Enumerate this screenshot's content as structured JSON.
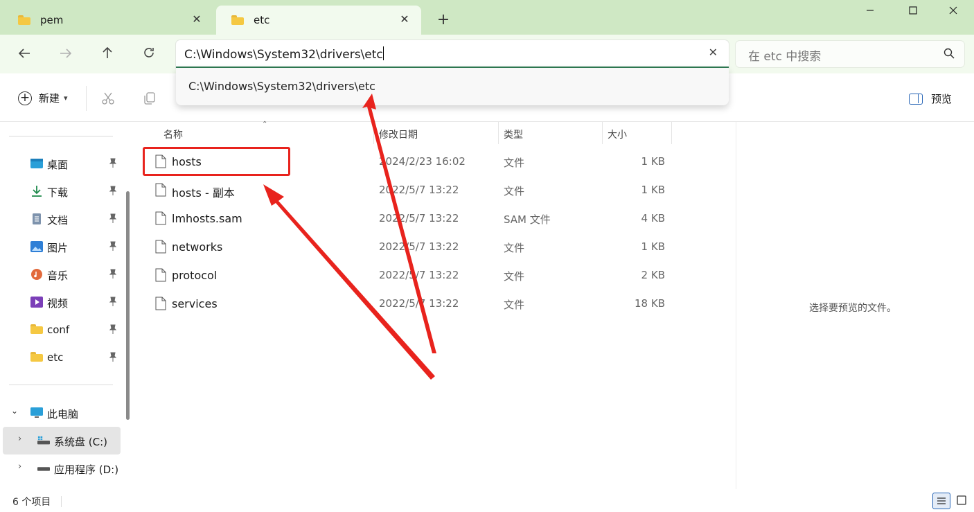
{
  "tabs": [
    {
      "label": "pem"
    },
    {
      "label": "etc"
    }
  ],
  "address": {
    "value": "C:\\Windows\\System32\\drivers\\etc",
    "suggestion": "C:\\Windows\\System32\\drivers\\etc"
  },
  "search": {
    "placeholder": "在 etc 中搜索"
  },
  "toolbar": {
    "new_label": "新建",
    "preview_label": "预览"
  },
  "sidebar": {
    "quick_access": [
      {
        "label": "桌面",
        "icon": "desktop-icon"
      },
      {
        "label": "下载",
        "icon": "download-icon"
      },
      {
        "label": "文档",
        "icon": "document-icon"
      },
      {
        "label": "图片",
        "icon": "picture-icon"
      },
      {
        "label": "音乐",
        "icon": "music-icon"
      },
      {
        "label": "视频",
        "icon": "video-icon"
      },
      {
        "label": "conf",
        "icon": "folder-icon"
      },
      {
        "label": "etc",
        "icon": "folder-icon"
      }
    ],
    "this_pc": {
      "label": "此电脑"
    },
    "drives": [
      {
        "label": "系统盘 (C:)"
      },
      {
        "label": "应用程序 (D:)"
      }
    ]
  },
  "columns": {
    "name": "名称",
    "date": "修改日期",
    "type": "类型",
    "size": "大小"
  },
  "files": [
    {
      "name": "hosts",
      "date": "2024/2/23 16:02",
      "type": "文件",
      "size": "1 KB"
    },
    {
      "name": "hosts - 副本",
      "date": "2022/5/7 13:22",
      "type": "文件",
      "size": "1 KB"
    },
    {
      "name": "lmhosts.sam",
      "date": "2022/5/7 13:22",
      "type": "SAM 文件",
      "size": "4 KB"
    },
    {
      "name": "networks",
      "date": "2022/5/7 13:22",
      "type": "文件",
      "size": "1 KB"
    },
    {
      "name": "protocol",
      "date": "2022/5/7 13:22",
      "type": "文件",
      "size": "2 KB"
    },
    {
      "name": "services",
      "date": "2022/5/7 13:22",
      "type": "文件",
      "size": "18 KB"
    }
  ],
  "preview": {
    "message": "选择要预览的文件。"
  },
  "status": {
    "count": "6 个项目"
  },
  "colors": {
    "titlebar": "#cfe8c4",
    "navrow": "#f2faee",
    "accent": "#2f7a53",
    "annotation_red": "#e8231d"
  }
}
